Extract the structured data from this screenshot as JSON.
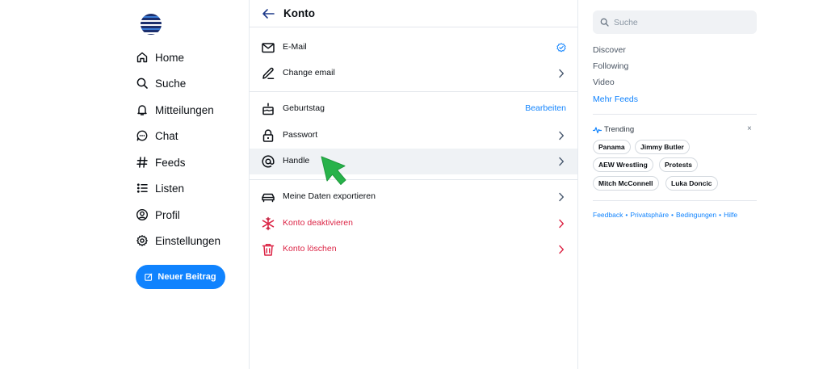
{
  "sidebar": {
    "items": [
      {
        "label": "Home",
        "icon": "home-icon"
      },
      {
        "label": "Suche",
        "icon": "search-icon"
      },
      {
        "label": "Mitteilungen",
        "icon": "bell-icon"
      },
      {
        "label": "Chat",
        "icon": "chat-bubble-icon"
      },
      {
        "label": "Feeds",
        "icon": "hash-icon"
      },
      {
        "label": "Listen",
        "icon": "list-icon"
      },
      {
        "label": "Profil",
        "icon": "user-circle-icon"
      },
      {
        "label": "Einstellungen",
        "icon": "gear-icon"
      }
    ],
    "new_post_label": "Neuer Beitrag"
  },
  "header": {
    "title": "Konto"
  },
  "settings": {
    "rows": [
      {
        "label": "E-Mail",
        "icon": "envelope-icon",
        "trailing": "verified-check-icon"
      },
      {
        "label": "Change email",
        "icon": "pencil-icon",
        "trailing": "chevron-right-icon"
      },
      {
        "label": "Geburtstag",
        "icon": "cake-icon",
        "action": "Bearbeiten"
      },
      {
        "label": "Passwort",
        "icon": "lock-icon",
        "trailing": "chevron-right-icon"
      },
      {
        "label": "Handle",
        "icon": "at-sign-icon",
        "trailing": "chevron-right-icon",
        "hovered": true
      },
      {
        "label": "Meine Daten exportieren",
        "icon": "car-export-icon",
        "trailing": "chevron-right-icon"
      },
      {
        "label": "Konto deaktivieren",
        "icon": "snowflake-icon",
        "trailing": "chevron-right-icon",
        "danger": true
      },
      {
        "label": "Konto löschen",
        "icon": "trash-icon",
        "trailing": "chevron-right-icon",
        "danger": true
      }
    ]
  },
  "right": {
    "search_placeholder": "Suche",
    "feeds": [
      "Discover",
      "Following",
      "Video"
    ],
    "more_feeds": "Mehr Feeds",
    "trending_title": "Trending",
    "trending_close": "×",
    "trending": [
      "Panama",
      "Jimmy Butler",
      "AEW Wrestling",
      "Protests",
      "Mitch McConnell",
      "Luka Doncic"
    ],
    "footer": [
      "Feedback",
      "Privatsphäre",
      "Bedingungen",
      "Hilfe"
    ],
    "footer_separator": "•"
  },
  "colors": {
    "accent": "#1083fe",
    "danger": "#dc2546",
    "cursor": "#27b24a",
    "hover_row": "#eff2f5"
  }
}
